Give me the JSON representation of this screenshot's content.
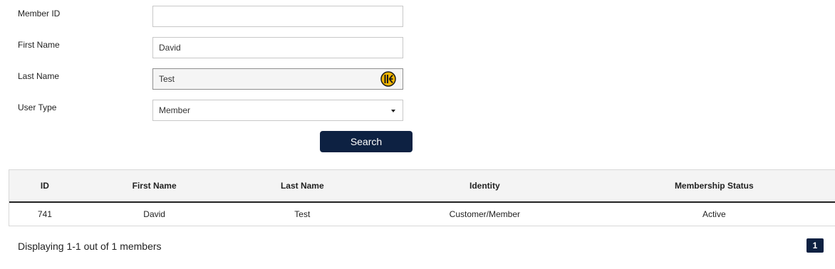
{
  "form": {
    "member_id": {
      "label": "Member ID",
      "value": ""
    },
    "first_name": {
      "label": "First Name",
      "value": "David"
    },
    "last_name": {
      "label": "Last Name",
      "value": "Test"
    },
    "user_type": {
      "label": "User Type",
      "selected": "Member"
    },
    "search_label": "Search",
    "keeper_icon": "keeper-autofill-icon"
  },
  "table": {
    "columns": [
      "ID",
      "First Name",
      "Last Name",
      "Identity",
      "Membership Status"
    ],
    "rows": [
      {
        "id": "741",
        "first_name": "David",
        "last_name": "Test",
        "identity": "Customer/Member",
        "status": "Active"
      }
    ]
  },
  "footer": {
    "summary": "Displaying 1-1 out of 1 members",
    "pages": [
      "1"
    ]
  },
  "colors": {
    "button_bg": "#0d2142",
    "keeper_yellow": "#f5b700"
  }
}
